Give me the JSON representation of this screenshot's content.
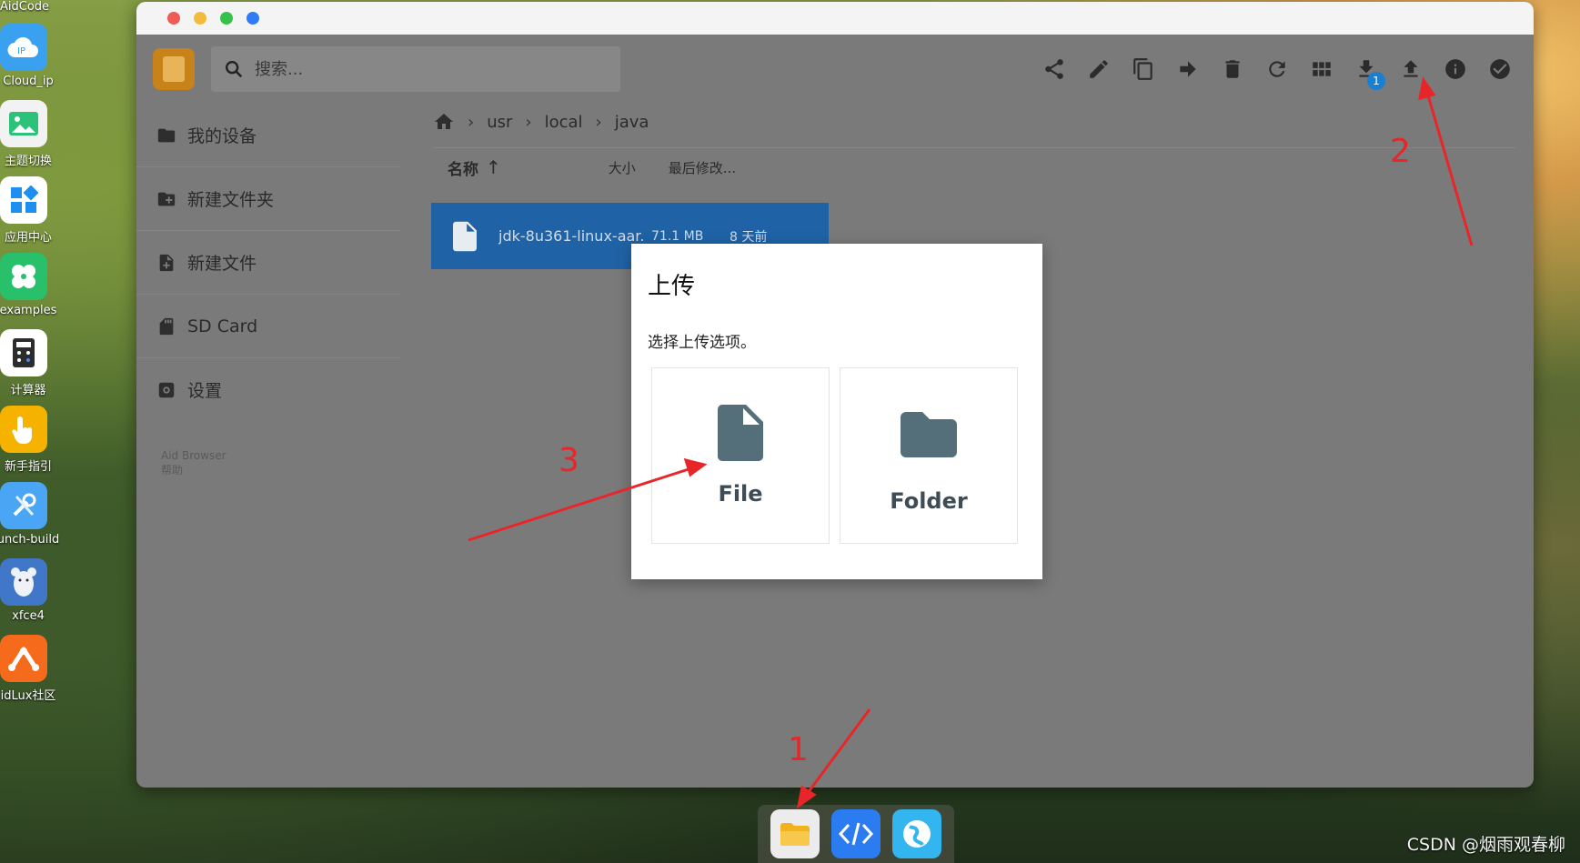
{
  "desktop": {
    "top_label": "AidCode",
    "items": [
      {
        "label": "Cloud_ip",
        "icon": "cloud-ip-icon",
        "color": "#3aa0f0"
      },
      {
        "label": "主题切换",
        "icon": "image-icon",
        "color": "#2dc27a"
      },
      {
        "label": "应用中心",
        "icon": "apps-grid-icon",
        "color": "#ffffff"
      },
      {
        "label": "examples",
        "icon": "clover-icon",
        "color": "#28c06a"
      },
      {
        "label": "计算器",
        "icon": "calculator-icon",
        "color": "#ffffff"
      },
      {
        "label": "新手指引",
        "icon": "hand-pointer-icon",
        "color": "#f5b300"
      },
      {
        "label": "unch-build",
        "icon": "tools-icon",
        "color": "#4aa6f5"
      },
      {
        "label": "xfce4",
        "icon": "mouse-icon",
        "color": "#4177c9"
      },
      {
        "label": "idLux社区",
        "icon": "community-icon",
        "color": "#f56a1b"
      }
    ]
  },
  "window": {
    "search_placeholder": "搜索...",
    "download_badge": "1"
  },
  "sidebar": {
    "items": [
      {
        "label": "我的设备",
        "icon": "folder-icon"
      },
      {
        "label": "新建文件夹",
        "icon": "new-folder-icon"
      },
      {
        "label": "新建文件",
        "icon": "new-file-icon"
      },
      {
        "label": "SD Card",
        "icon": "sd-card-icon"
      },
      {
        "label": "设置",
        "icon": "settings-icon"
      }
    ],
    "footer_line1": "Aid Browser",
    "footer_line2": "帮助"
  },
  "breadcrumb": [
    "usr",
    "local",
    "java"
  ],
  "list": {
    "col_name": "名称",
    "col_size": "大小",
    "col_modified": "最后修改...",
    "rows": [
      {
        "name": "jdk-8u361-linux-aar...",
        "size": "71.1 MB",
        "modified": "8 天前"
      }
    ]
  },
  "modal": {
    "title": "上传",
    "subtitle": "选择上传选项。",
    "option_file": "File",
    "option_folder": "Folder"
  },
  "annotations": {
    "n1": "1",
    "n2": "2",
    "n3": "3"
  },
  "watermark": "CSDN @烟雨观春柳"
}
